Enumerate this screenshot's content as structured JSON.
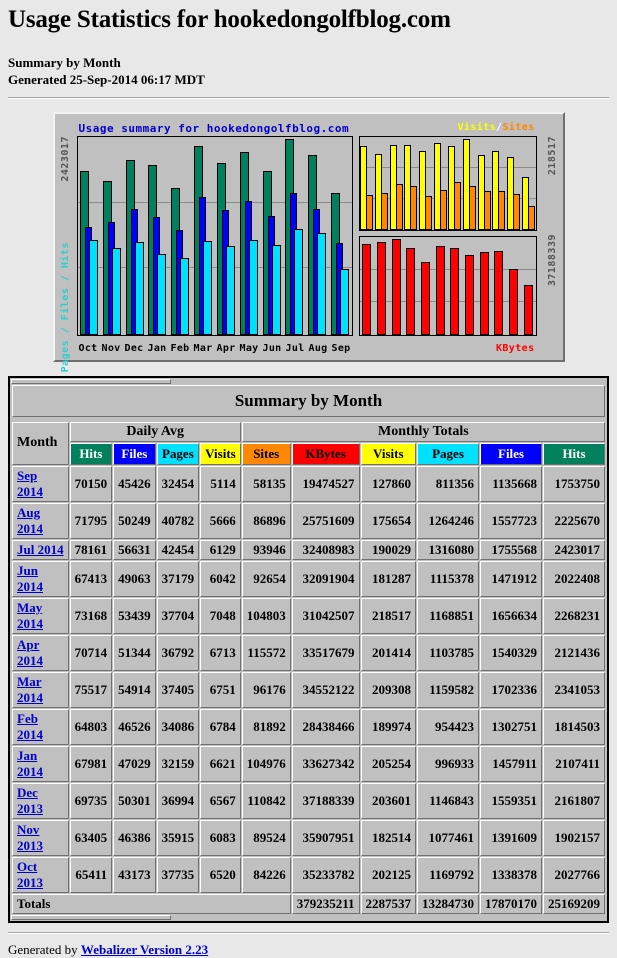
{
  "header": {
    "title": "Usage Statistics for hookedongolfblog.com",
    "summary_line": "Summary by Month",
    "generated_line": "Generated 25-Sep-2014 06:17 MDT"
  },
  "chart_meta": {
    "title": "Usage summary for hookedongolfblog.com",
    "legend_visits": "Visits",
    "legend_slash": "/",
    "legend_sites": "Sites",
    "left_axis_max": "2423017",
    "left_axis_label": "Pages / Files / Hits",
    "right_axis_top_max": "218517",
    "right_axis_bottom_max": "37188339",
    "kbytes_label": "KBytes"
  },
  "chart_data": {
    "type": "bar",
    "title": "Usage summary for hookedongolfblog.com",
    "xlabel": "",
    "ylabel": "Pages / Files / Hits",
    "grid": true,
    "legend": "Visits / Sites",
    "categories": [
      "Oct",
      "Nov",
      "Dec",
      "Jan",
      "Feb",
      "Mar",
      "Apr",
      "May",
      "Jun",
      "Jul",
      "Aug",
      "Sep"
    ],
    "panels": [
      {
        "name": "Pages / Files / Hits",
        "ylim": [
          0,
          2423017
        ],
        "series": [
          {
            "name": "Hits",
            "color": "#00805C",
            "values": [
              2027766,
              1902157,
              2161807,
              2107411,
              1814503,
              2341053,
              2121436,
              2268231,
              2022408,
              2423017,
              2225670,
              1753750
            ]
          },
          {
            "name": "Files",
            "color": "#0000FF",
            "values": [
              1338378,
              1391609,
              1559351,
              1457911,
              1302751,
              1702336,
              1540329,
              1656634,
              1471912,
              1755568,
              1557723,
              1135668
            ]
          },
          {
            "name": "Pages",
            "color": "#00E0FF",
            "values": [
              1169792,
              1077461,
              1146843,
              996933,
              954423,
              1159582,
              1103785,
              1168851,
              1115378,
              1316080,
              1264246,
              811356
            ]
          }
        ]
      },
      {
        "name": "Visits / Sites",
        "ylim": [
          0,
          218517
        ],
        "series": [
          {
            "name": "Visits",
            "color": "#FFFF00",
            "values": [
              202125,
              182514,
              203601,
              205254,
              189974,
              209308,
              201414,
              218517,
              181287,
              190029,
              175654,
              127860
            ]
          },
          {
            "name": "Sites",
            "color": "#FF8800",
            "values": [
              84226,
              89524,
              110842,
              104976,
              81892,
              96176,
              115572,
              104803,
              92654,
              93946,
              86896,
              58135
            ]
          }
        ]
      },
      {
        "name": "KBytes",
        "ylim": [
          0,
          37188339
        ],
        "series": [
          {
            "name": "KBytes",
            "color": "#FF0000",
            "values": [
              35233782,
              35907951,
              37188339,
              33627342,
              28438466,
              34552122,
              33517679,
              31042507,
              32091904,
              32408983,
              25751609,
              19474527
            ]
          }
        ]
      }
    ]
  },
  "table": {
    "caption": "Summary by Month",
    "group_headers": {
      "month": "Month",
      "daily_avg": "Daily Avg",
      "monthly_totals": "Monthly Totals"
    },
    "columns": [
      {
        "key": "avg_hits",
        "label": "Hits",
        "style": "ch-hits"
      },
      {
        "key": "avg_files",
        "label": "Files",
        "style": "ch-files"
      },
      {
        "key": "avg_pages",
        "label": "Pages",
        "style": "ch-pages"
      },
      {
        "key": "avg_visits",
        "label": "Visits",
        "style": "ch-visits"
      },
      {
        "key": "tot_sites",
        "label": "Sites",
        "style": "ch-sites"
      },
      {
        "key": "tot_kbytes",
        "label": "KBytes",
        "style": "ch-kbytes"
      },
      {
        "key": "tot_visits",
        "label": "Visits",
        "style": "ch-visits"
      },
      {
        "key": "tot_pages",
        "label": "Pages",
        "style": "ch-pages"
      },
      {
        "key": "tot_files",
        "label": "Files",
        "style": "ch-files"
      },
      {
        "key": "tot_hits",
        "label": "Hits",
        "style": "ch-hits"
      }
    ],
    "rows": [
      {
        "month": "Sep 2014",
        "cells": [
          "70150",
          "45426",
          "32454",
          "5114",
          "58135",
          "19474527",
          "127860",
          "811356",
          "1135668",
          "1753750"
        ]
      },
      {
        "month": "Aug 2014",
        "cells": [
          "71795",
          "50249",
          "40782",
          "5666",
          "86896",
          "25751609",
          "175654",
          "1264246",
          "1557723",
          "2225670"
        ]
      },
      {
        "month": "Jul 2014",
        "cells": [
          "78161",
          "56631",
          "42454",
          "6129",
          "93946",
          "32408983",
          "190029",
          "1316080",
          "1755568",
          "2423017"
        ]
      },
      {
        "month": "Jun 2014",
        "cells": [
          "67413",
          "49063",
          "37179",
          "6042",
          "92654",
          "32091904",
          "181287",
          "1115378",
          "1471912",
          "2022408"
        ]
      },
      {
        "month": "May 2014",
        "cells": [
          "73168",
          "53439",
          "37704",
          "7048",
          "104803",
          "31042507",
          "218517",
          "1168851",
          "1656634",
          "2268231"
        ]
      },
      {
        "month": "Apr 2014",
        "cells": [
          "70714",
          "51344",
          "36792",
          "6713",
          "115572",
          "33517679",
          "201414",
          "1103785",
          "1540329",
          "2121436"
        ]
      },
      {
        "month": "Mar 2014",
        "cells": [
          "75517",
          "54914",
          "37405",
          "6751",
          "96176",
          "34552122",
          "209308",
          "1159582",
          "1702336",
          "2341053"
        ]
      },
      {
        "month": "Feb 2014",
        "cells": [
          "64803",
          "46526",
          "34086",
          "6784",
          "81892",
          "28438466",
          "189974",
          "954423",
          "1302751",
          "1814503"
        ]
      },
      {
        "month": "Jan 2014",
        "cells": [
          "67981",
          "47029",
          "32159",
          "6621",
          "104976",
          "33627342",
          "205254",
          "996933",
          "1457911",
          "2107411"
        ]
      },
      {
        "month": "Dec 2013",
        "cells": [
          "69735",
          "50301",
          "36994",
          "6567",
          "110842",
          "37188339",
          "203601",
          "1146843",
          "1559351",
          "2161807"
        ]
      },
      {
        "month": "Nov 2013",
        "cells": [
          "63405",
          "46386",
          "35915",
          "6083",
          "89524",
          "35907951",
          "182514",
          "1077461",
          "1391609",
          "1902157"
        ]
      },
      {
        "month": "Oct 2013",
        "cells": [
          "65411",
          "43173",
          "37735",
          "6520",
          "84226",
          "35233782",
          "202125",
          "1169792",
          "1338378",
          "2027766"
        ]
      }
    ],
    "totals": {
      "label": "Totals",
      "values": [
        "379235211",
        "2287537",
        "13284730",
        "17870170",
        "25169209"
      ]
    }
  },
  "footer": {
    "prefix": "Generated by ",
    "link": "Webalizer Version 2.23"
  }
}
